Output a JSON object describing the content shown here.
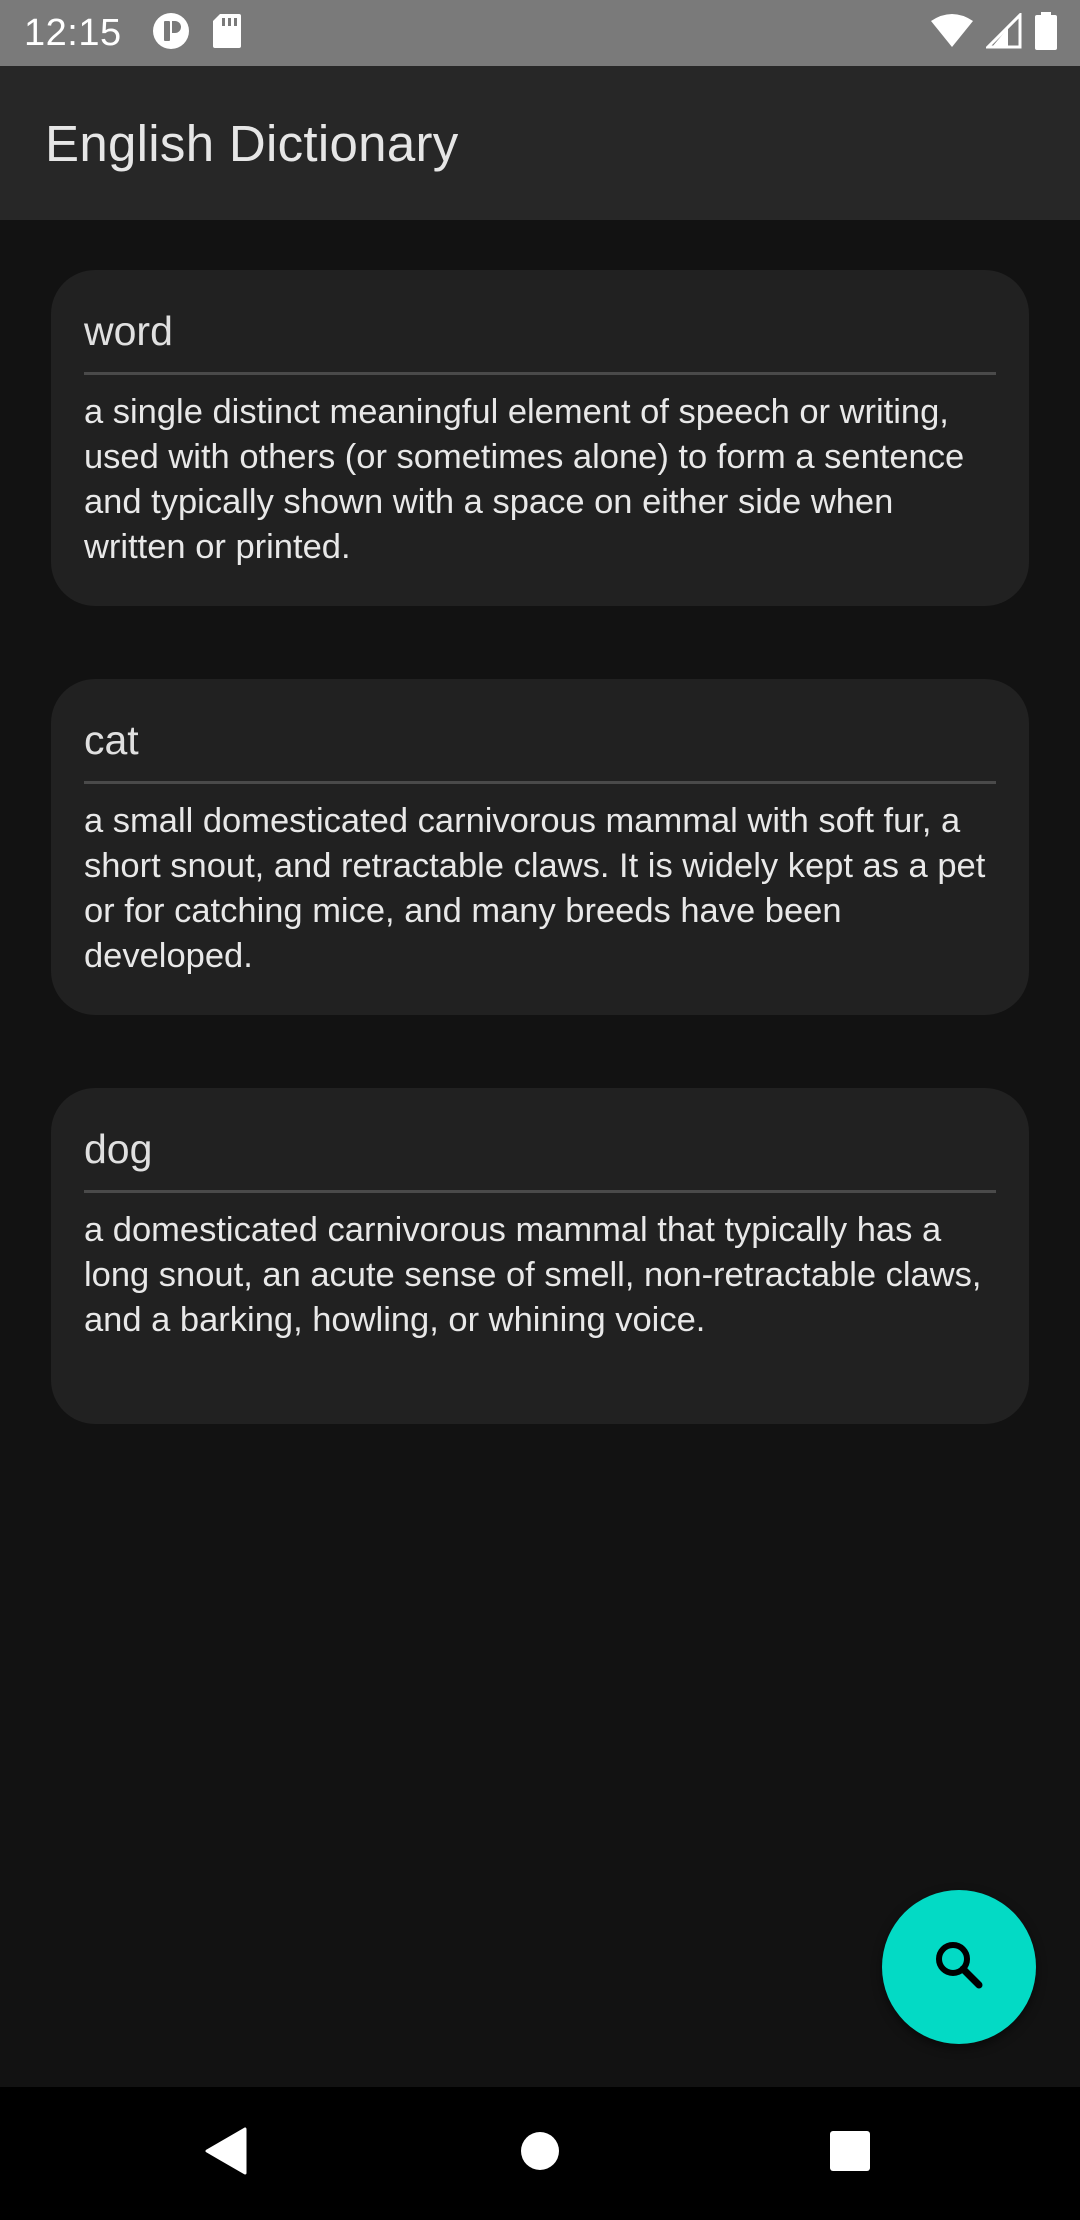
{
  "status_bar": {
    "time": "12:15",
    "left_icons": [
      "app-notification-icon",
      "sd-card-icon"
    ],
    "right_icons": [
      "wifi-icon",
      "cell-signal-icon",
      "battery-icon"
    ]
  },
  "app_bar": {
    "title": "English Dictionary"
  },
  "entries": [
    {
      "term": "word",
      "definition": "a single distinct meaningful element of speech or writing, used with others (or sometimes alone) to form a sentence and typically shown with a space on either side when written or printed."
    },
    {
      "term": "cat",
      "definition": "a small domesticated carnivorous mammal with soft fur, a short snout, and retractable claws. It is widely kept as a pet or for catching mice, and many breeds have been developed."
    },
    {
      "term": "dog",
      "definition": "a domesticated carnivorous mammal that typically has a long snout, an acute sense of smell, non-retractable claws, and a barking, howling, or whining voice."
    }
  ],
  "fab": {
    "icon": "search-icon",
    "color": "#03dac5"
  },
  "nav_bar": {
    "buttons": [
      "back-icon",
      "home-icon",
      "recents-icon"
    ]
  }
}
